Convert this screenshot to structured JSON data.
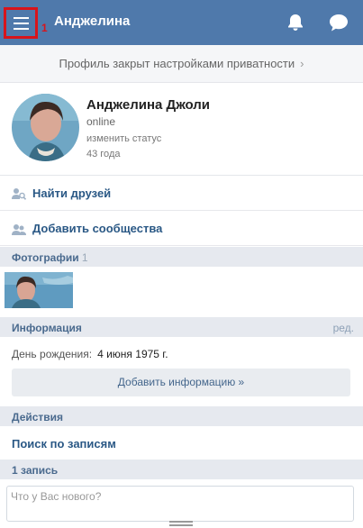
{
  "header": {
    "title": "Анджелина",
    "annotation_number": "1",
    "bg_color": "#4f79ab",
    "menu_icon": "hamburger-icon",
    "bell_icon": "bell-icon",
    "messages_icon": "chat-bubble-icon"
  },
  "privacy_notice": {
    "text": "Профиль закрыт настройками приватности",
    "chevron": "›"
  },
  "profile": {
    "name": "Анджелина Джоли",
    "online": "online",
    "status_link": "изменить статус",
    "age": "43 года"
  },
  "actions": {
    "find_friends": "Найти друзей",
    "add_communities": "Добавить сообщества"
  },
  "photos": {
    "title": "Фотографии",
    "count": "1"
  },
  "info": {
    "title": "Информация",
    "edit": "ред.",
    "birthday_label": "День рождения:",
    "birthday_value": "4 июня 1975 г.",
    "add_button": "Добавить информацию »"
  },
  "deeds": {
    "title": "Действия",
    "search_posts": "Поиск по записям"
  },
  "wall": {
    "title": "1 запись",
    "composer_placeholder": "Что у Вас нового?"
  }
}
